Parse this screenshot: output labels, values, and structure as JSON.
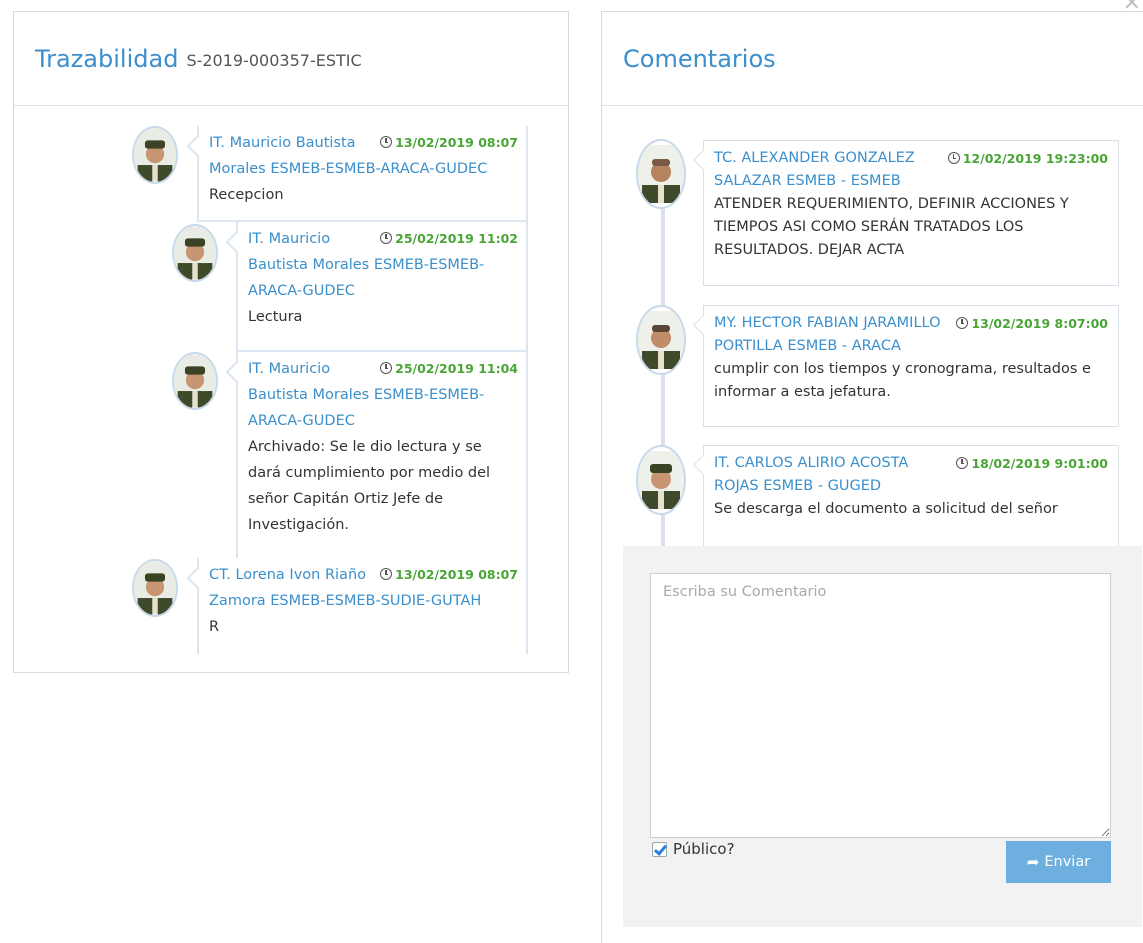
{
  "trazabilidad": {
    "title": "Trazabilidad",
    "doc_id": "S-2019-000357-ESTIC",
    "items": [
      {
        "name": "IT. Mauricio Bautista Morales ESMEB-ESMEB-ARACA-GUDEC",
        "time": "13/02/2019 08:07",
        "text": "Recepcion"
      },
      {
        "name": "IT. Mauricio Bautista Morales ESMEB-ESMEB-ARACA-GUDEC",
        "time": "25/02/2019 11:02",
        "text": "Lectura"
      },
      {
        "name": "IT. Mauricio Bautista Morales ESMEB-ESMEB-ARACA-GUDEC",
        "time": "25/02/2019 11:04",
        "text": "Archivado: Se le dio lectura y se dará cumplimiento por medio del señor Capitán Ortiz Jefe de Investigación."
      },
      {
        "name": "CT. Lorena Ivon Riaño Zamora ESMEB-ESMEB-SUDIE-GUTAH",
        "time": "13/02/2019 08:07",
        "text": "R"
      }
    ]
  },
  "comentarios": {
    "title": "Comentarios",
    "items": [
      {
        "name": "TC. ALEXANDER GONZALEZ SALAZAR ESMEB - ESMEB",
        "time": "12/02/2019 19:23:00",
        "text": "ATENDER REQUERIMIENTO, DEFINIR ACCIONES Y TIEMPOS ASI COMO SERÁN TRATADOS LOS RESULTADOS. DEJAR ACTA"
      },
      {
        "name": "MY. HECTOR FABIAN JARAMILLO PORTILLA ESMEB - ARACA",
        "time": "13/02/2019 8:07:00",
        "text": "cumplir con los tiempos y cronograma, resultados e informar a esta jefatura."
      },
      {
        "name": "IT. CARLOS ALIRIO ACOSTA ROJAS ESMEB - GUGED",
        "time": "18/02/2019 9:01:00",
        "text": "Se descarga el documento a solicitud del señor"
      }
    ],
    "input_placeholder": "Escriba su Comentario",
    "public_label": "Público?",
    "public_checked": true,
    "send_label": "Enviar"
  }
}
